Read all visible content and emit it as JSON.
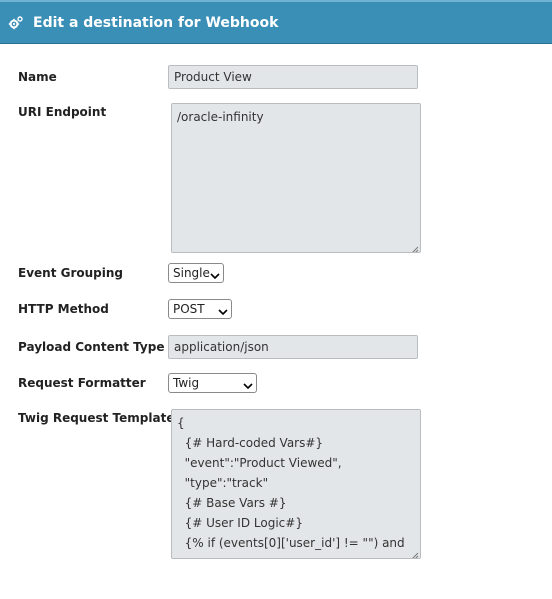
{
  "header": {
    "title": "Edit a destination for Webhook",
    "icon": "gears-icon",
    "color": "#3a8fb7"
  },
  "form": {
    "name": {
      "label": "Name",
      "value": "Product View"
    },
    "uri": {
      "label": "URI Endpoint",
      "value": "/oracle-infinity"
    },
    "event_grouping": {
      "label": "Event Grouping",
      "selected": "Single"
    },
    "http_method": {
      "label": "HTTP Method",
      "selected": "POST"
    },
    "payload_content_type": {
      "label": "Payload Content Type",
      "value": "application/json"
    },
    "request_formatter": {
      "label": "Request Formatter",
      "selected": "Twig"
    },
    "twig_template": {
      "label": "Twig Request Template",
      "lines": [
        "{",
        "  {# Hard-coded Vars#}",
        "  \"event\":\"Product Viewed\",",
        "  \"type\":\"track\"",
        "  {# Base Vars #}",
        "  {# User ID Logic#}",
        "  {% if (events[0]['user_id'] != \"\") and"
      ]
    }
  }
}
